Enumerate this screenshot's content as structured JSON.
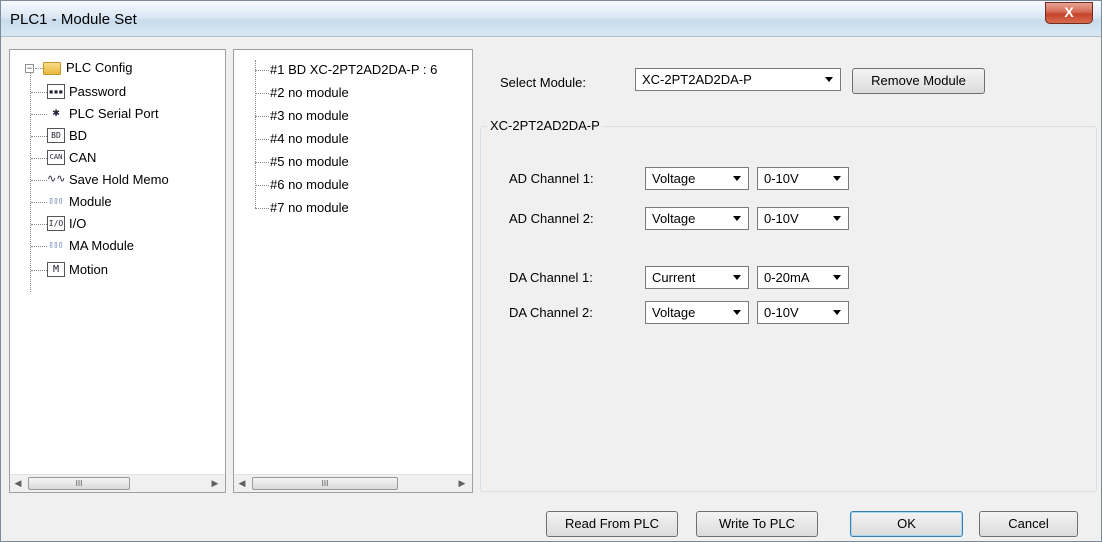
{
  "window": {
    "title": "PLC1 - Module  Set",
    "close_label": "X"
  },
  "tree": {
    "root": "PLC Config",
    "root_expander": "−",
    "items": [
      {
        "label": "Password",
        "icon": "password-icon",
        "glyph": "▪▪▪"
      },
      {
        "label": "PLC Serial Port",
        "icon": "serial-port-icon",
        "glyph": "✱"
      },
      {
        "label": "BD",
        "icon": "bd-icon",
        "glyph": "BD"
      },
      {
        "label": "CAN",
        "icon": "can-icon",
        "glyph": "CAN"
      },
      {
        "label": "Save Hold Memo",
        "icon": "save-hold-icon",
        "glyph": "∿∿"
      },
      {
        "label": "Module",
        "icon": "module-icon",
        "glyph": "▯▯▯"
      },
      {
        "label": "I/O",
        "icon": "io-icon",
        "glyph": "I/O"
      },
      {
        "label": "MA Module",
        "icon": "ma-module-icon",
        "glyph": "▯▯▯"
      },
      {
        "label": "Motion",
        "icon": "motion-icon",
        "glyph": "M"
      }
    ],
    "scroll_thumb": "III"
  },
  "modules": {
    "items": [
      "#1 BD XC-2PT2AD2DA-P : 6",
      "#2 no module",
      "#3 no module",
      "#4 no module",
      "#5 no module",
      "#6 no module",
      "#7 no module"
    ],
    "scroll_thumb": "III"
  },
  "config": {
    "select_label": "Select Module:",
    "select_value": "XC-2PT2AD2DA-P",
    "remove_button": "Remove Module",
    "group_title": "XC-2PT2AD2DA-P",
    "ad1": {
      "label": "AD Channel 1:",
      "type": "Voltage",
      "range": "0-10V"
    },
    "ad2": {
      "label": "AD Channel 2:",
      "type": "Voltage",
      "range": "0-10V"
    },
    "da1": {
      "label": "DA Channel 1:",
      "type": "Current",
      "range": "0-20mA"
    },
    "da2": {
      "label": "DA Channel 2:",
      "type": "Voltage",
      "range": "0-10V"
    }
  },
  "buttons": {
    "read": "Read From PLC",
    "write": "Write To PLC",
    "ok": "OK",
    "cancel": "Cancel"
  },
  "colors": {
    "close_button": "#c4442b",
    "titlebar": "#dbe8f3",
    "dialog_bg": "#f0f0f0"
  }
}
